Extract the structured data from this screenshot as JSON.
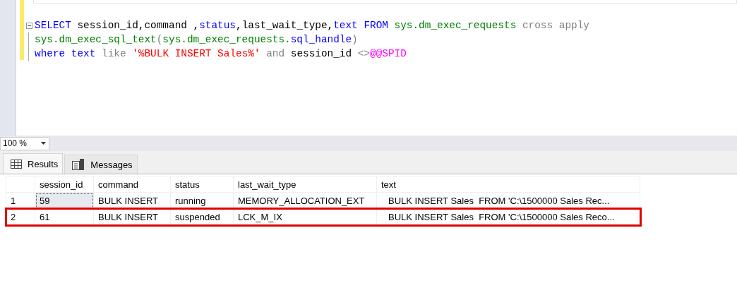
{
  "editor": {
    "lines": [
      {
        "collapsible": true,
        "tokens": [
          {
            "kind": "keyword",
            "text": "SELECT"
          },
          {
            "kind": "plain",
            "text": " session_id,command ,"
          },
          {
            "kind": "keyword",
            "text": "status"
          },
          {
            "kind": "plain",
            "text": ",last_wait_type,"
          },
          {
            "kind": "keyword",
            "text": "text"
          },
          {
            "kind": "keyword",
            "text": " FROM"
          },
          {
            "kind": "object",
            "text": " sys.dm_exec_requests"
          },
          {
            "kind": "operator",
            "text": " cross apply"
          }
        ]
      },
      {
        "collapsible": false,
        "tokens": [
          {
            "kind": "object",
            "text": "sys.dm_exec_sql_text"
          },
          {
            "kind": "operator",
            "text": "("
          },
          {
            "kind": "object",
            "text": "sys.dm_exec_requests."
          },
          {
            "kind": "keyword",
            "text": "sql_handle"
          },
          {
            "kind": "operator",
            "text": ")"
          }
        ]
      },
      {
        "collapsible": false,
        "tokens": [
          {
            "kind": "keyword",
            "text": "where"
          },
          {
            "kind": "keyword",
            "text": " text"
          },
          {
            "kind": "operator",
            "text": " like "
          },
          {
            "kind": "string",
            "text": "'%BULK INSERT Sales%'"
          },
          {
            "kind": "operator",
            "text": " and"
          },
          {
            "kind": "plain",
            "text": " session_id "
          },
          {
            "kind": "operator",
            "text": "<>"
          },
          {
            "kind": "variable",
            "text": "@@SPID"
          }
        ]
      }
    ]
  },
  "zoom": {
    "value": "100 %"
  },
  "tabs": [
    {
      "label": "Results",
      "selected": true
    },
    {
      "label": "Messages",
      "selected": false
    }
  ],
  "grid": {
    "columns": [
      "session_id",
      "command",
      "status",
      "last_wait_type",
      "text"
    ],
    "rows": [
      {
        "number": "1",
        "focused": true,
        "highlighted": false,
        "cells": [
          "59",
          "BULK INSERT",
          "running",
          "MEMORY_ALLOCATION_EXT",
          "BULK INSERT Sales  FROM 'C:\\1500000 Sales Rec..."
        ]
      },
      {
        "number": "2",
        "focused": false,
        "highlighted": true,
        "cells": [
          "61",
          "BULK INSERT",
          "suspended",
          "LCK_M_IX",
          "BULK INSERT Sales  FROM 'C:\\1500000 Sales Reco..."
        ]
      }
    ]
  }
}
